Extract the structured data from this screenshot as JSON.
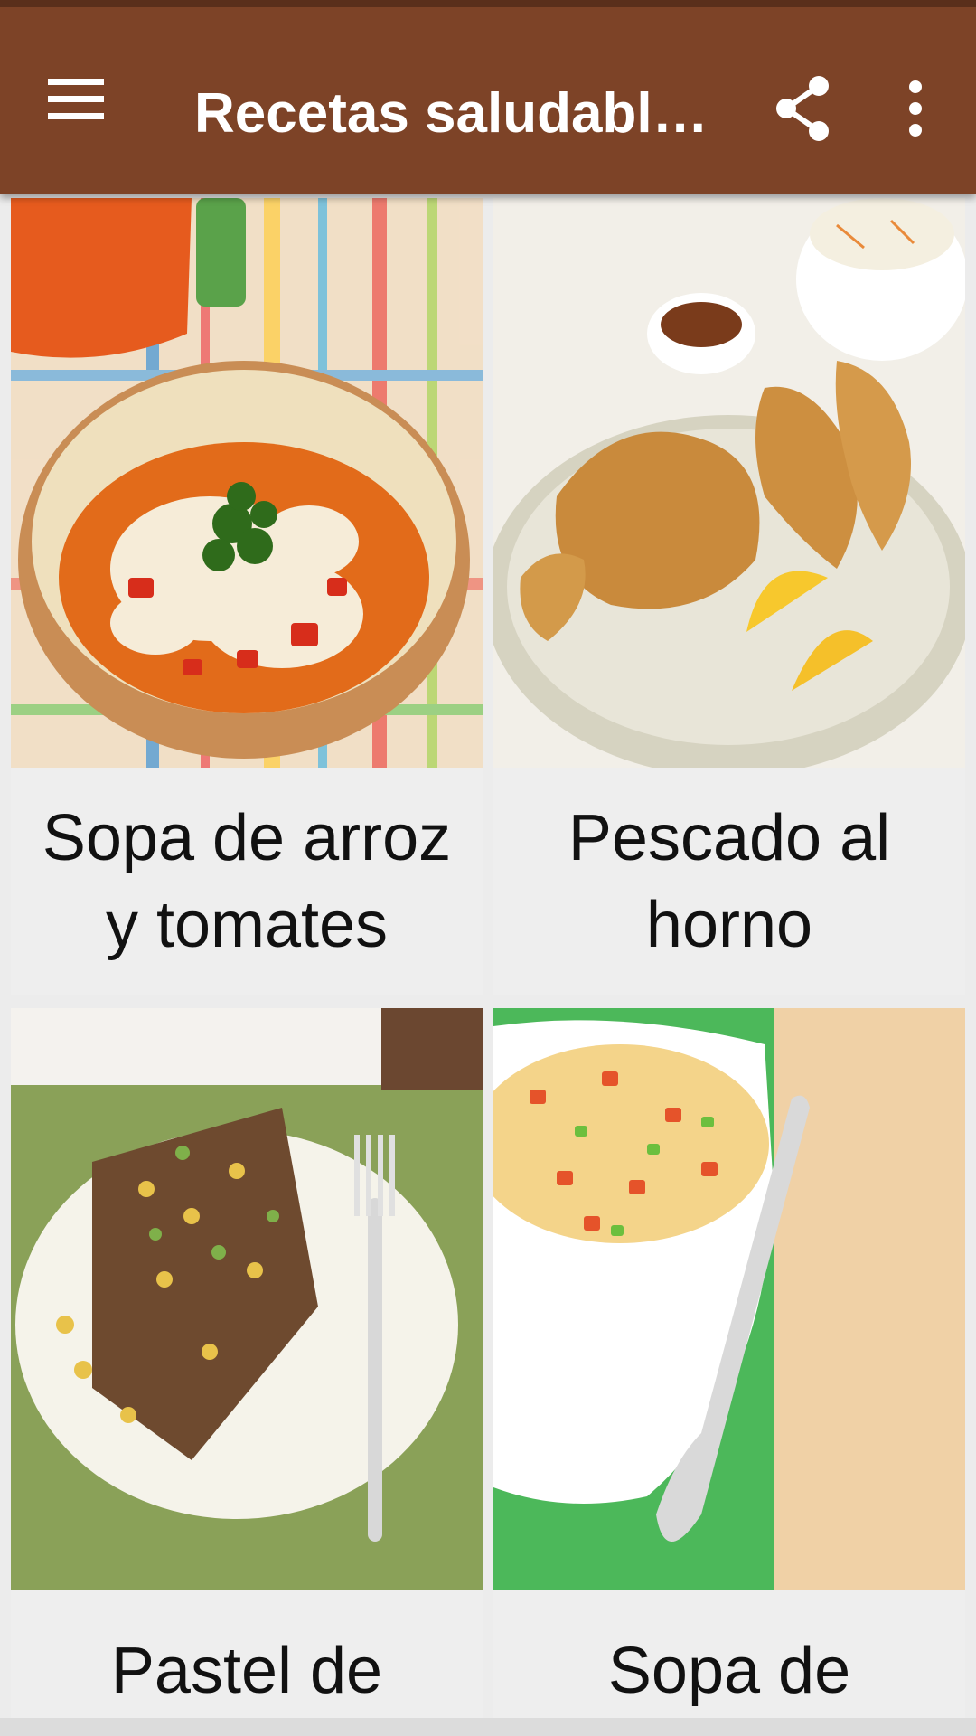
{
  "appbar": {
    "title": "Recetas saludables...",
    "menu_icon": "hamburger-menu-icon",
    "share_icon": "share-icon",
    "more_icon": "more-vert-icon",
    "color": "#7d4327"
  },
  "recipes": [
    {
      "label": "Sopa de arroz\ny tomates",
      "image": "rice-tomato-soup-bowl"
    },
    {
      "label": "Pescado  al\nhorno",
      "image": "baked-fish-fillets"
    },
    {
      "label": "Pastel de",
      "image": "layered-beef-corn-casserole"
    },
    {
      "label": "Sopa de",
      "image": "vegetable-soup-bowl"
    }
  ]
}
